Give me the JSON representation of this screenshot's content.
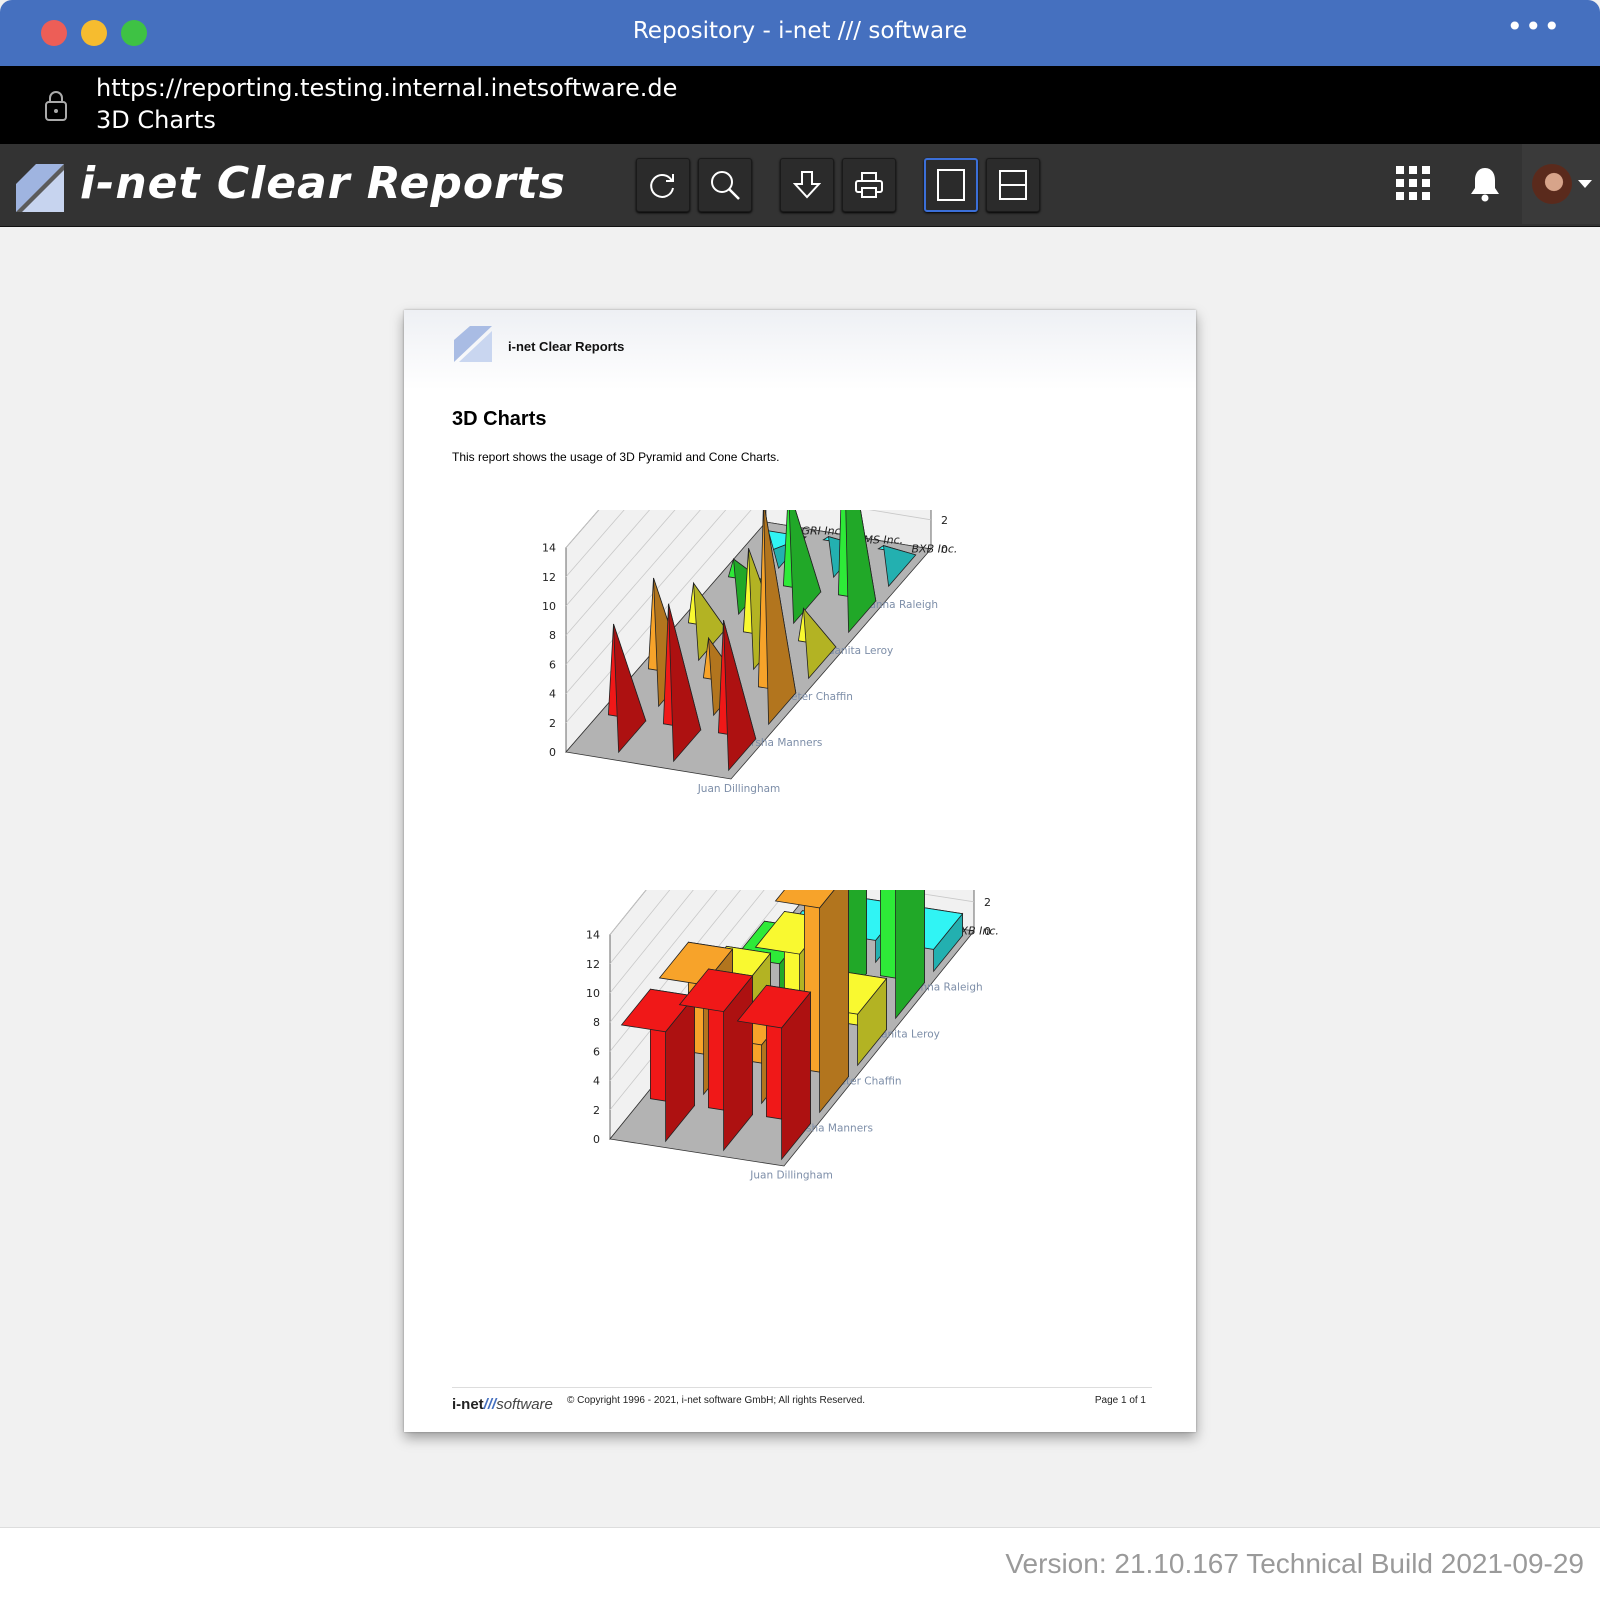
{
  "window": {
    "title": "Repository - i-net /// software",
    "more_icon": "more-horizontal-icon"
  },
  "address": {
    "url": "https://reporting.testing.internal.inetsoftware.de",
    "page_title": "3D Charts"
  },
  "app": {
    "name": "i-net Clear Reports"
  },
  "toolbar": {
    "refresh": "refresh-icon",
    "search": "search-icon",
    "download": "download-icon",
    "print": "print-icon",
    "single_page": "single-page-icon",
    "page_width": "fit-width-icon"
  },
  "report": {
    "brand": "i-net Clear Reports",
    "title": "3D Charts",
    "description": "This report shows the usage of 3D Pyramid and Cone Charts.",
    "footer": {
      "brand_a": "i-net",
      "brand_b": "///",
      "brand_c": "software",
      "copyright": "© Copyright 1996 - 2021, i-net software GmbH; All rights Reserved.",
      "page": "Page 1 of 1"
    }
  },
  "chart_data": [
    {
      "type": "bar",
      "subtype": "3d-pyramid",
      "categories": [
        "Juan Dillingham",
        "Marsha Manners",
        "Peter Chaffin",
        "Juanita Leroy",
        "Joanna Raleigh"
      ],
      "series": [
        {
          "name": "GRI Inc.",
          "values": [
            7.5,
            7.5,
            4,
            2.5,
            0
          ]
        },
        {
          "name": "EMS Inc.",
          "values": [
            9.5,
            4,
            7,
            8,
            1.5
          ]
        },
        {
          "name": "BXB Inc.",
          "values": [
            9,
            14,
            3.5,
            14,
            1.5
          ]
        }
      ],
      "axis_ticks": [
        "0",
        "2",
        "4",
        "6",
        "8",
        "10",
        "12",
        "14"
      ],
      "ylim": [
        0,
        14
      ],
      "grid": true
    },
    {
      "type": "bar",
      "subtype": "3d-box",
      "categories": [
        "Juan Dillingham",
        "Marsha Manners",
        "Peter Chaffin",
        "Juanita Leroy",
        "Joanna Raleigh"
      ],
      "series": [
        {
          "name": "GRI Inc.",
          "values": [
            7.5,
            7.5,
            4,
            2.5,
            0
          ]
        },
        {
          "name": "EMS Inc.",
          "values": [
            9.5,
            4,
            7,
            8,
            1.5
          ]
        },
        {
          "name": "BXB Inc.",
          "values": [
            9,
            14,
            3.5,
            14,
            1.5
          ]
        }
      ],
      "axis_ticks": [
        "0",
        "2",
        "4",
        "6",
        "8",
        "10",
        "12",
        "14"
      ],
      "ylim": [
        0,
        14
      ],
      "grid": true
    }
  ],
  "colors": {
    "red": "#f01818",
    "orange": "#f7a32a",
    "yellow": "#f9f930",
    "green": "#2eea38",
    "cyan": "#30f4f4",
    "accent": "#4570bf"
  },
  "status": {
    "version": "Version: 21.10.167 Technical Build 2021-09-29"
  }
}
